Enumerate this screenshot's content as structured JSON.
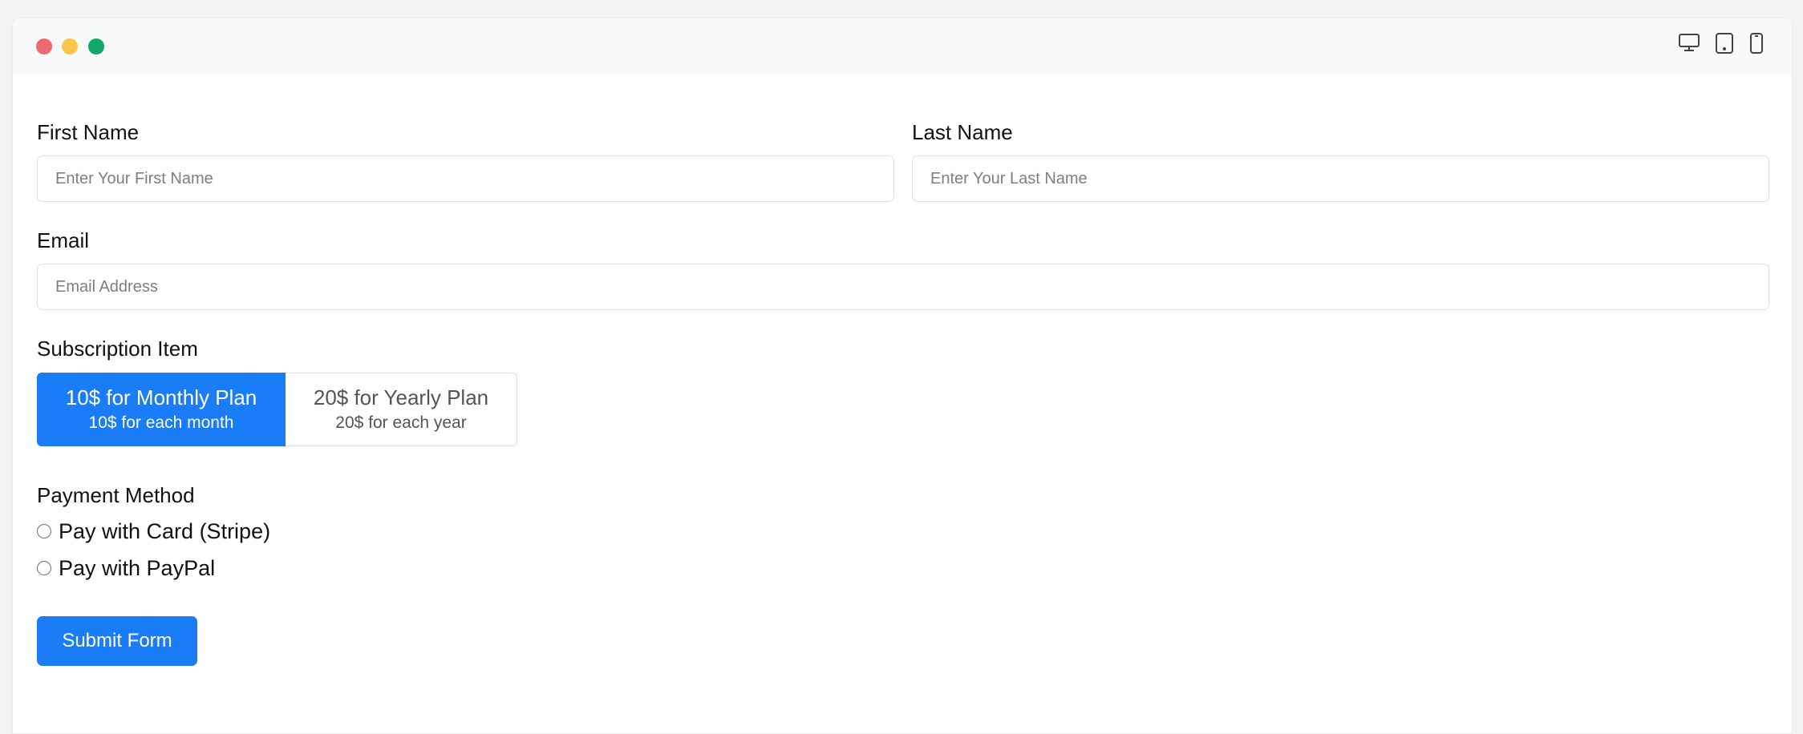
{
  "window": {
    "controls": [
      "close",
      "minimize",
      "maximize"
    ],
    "device_icons": [
      "desktop-icon",
      "tablet-icon",
      "mobile-icon"
    ]
  },
  "form": {
    "first_name": {
      "label": "First Name",
      "placeholder": "Enter Your First Name",
      "value": ""
    },
    "last_name": {
      "label": "Last Name",
      "placeholder": "Enter Your Last Name",
      "value": ""
    },
    "email": {
      "label": "Email",
      "placeholder": "Email Address",
      "value": ""
    },
    "subscription": {
      "label": "Subscription Item",
      "plans": [
        {
          "title": "10$ for Monthly Plan",
          "subtitle": "10$ for each month",
          "selected": true
        },
        {
          "title": "20$ for Yearly Plan",
          "subtitle": "20$ for each year",
          "selected": false
        }
      ]
    },
    "payment": {
      "label": "Payment Method",
      "options": [
        {
          "label": "Pay with Card (Stripe)",
          "checked": false
        },
        {
          "label": "Pay with PayPal",
          "checked": false
        }
      ]
    },
    "submit_label": "Submit Form"
  },
  "colors": {
    "accent": "#1a7cf7",
    "dot_red": "#ed6a6f",
    "dot_yellow": "#f8c648",
    "dot_green": "#10a86a"
  }
}
